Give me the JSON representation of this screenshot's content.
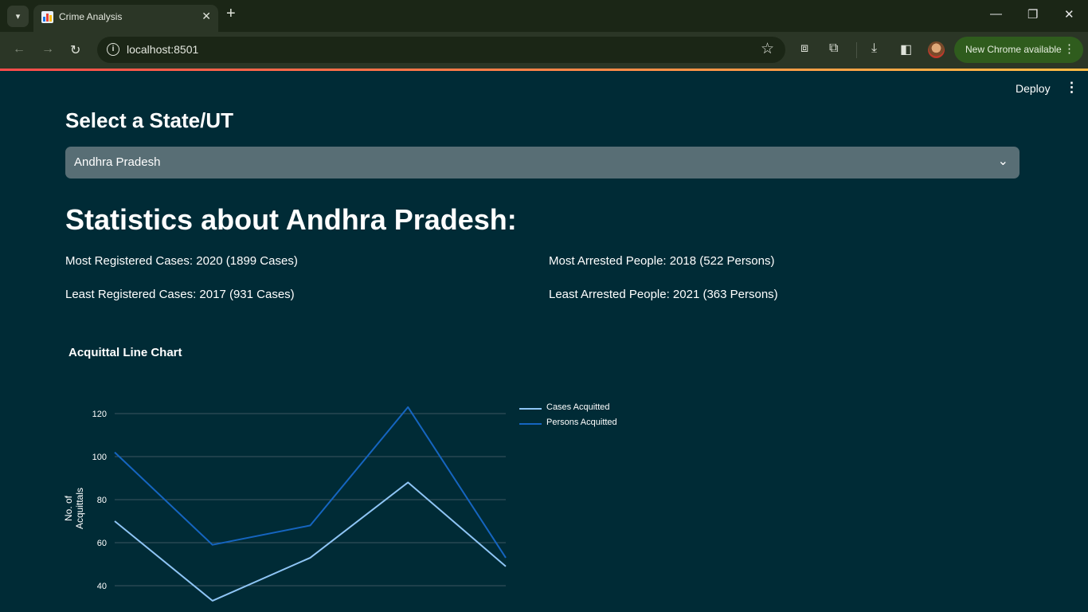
{
  "browser": {
    "tab_title": "Crime Analysis",
    "url": "localhost:8501",
    "update_label": "New Chrome available"
  },
  "app": {
    "deploy_label": "Deploy",
    "select_heading": "Select a State/UT",
    "selected_state": "Andhra Pradesh",
    "stats_heading": "Statistics about Andhra Pradesh:",
    "stats": {
      "most_registered": "Most Registered Cases: 2020 (1899 Cases)",
      "least_registered": "Least Registered Cases: 2017 (931 Cases)",
      "most_arrested": "Most Arrested People: 2018 (522 Persons)",
      "least_arrested": "Least Arrested People: 2021 (363 Persons)"
    },
    "chart_title": "Acquittal Line Chart"
  },
  "colors": {
    "background": "#002b36",
    "selectbox": "#586e75",
    "cases_line": "#8ec5f5",
    "persons_line": "#1565c0"
  },
  "icons": {
    "tab_favicon": "bar-chart-icon",
    "tab_close": "close-icon",
    "new_tab": "plus-icon",
    "back": "arrow-left-icon",
    "forward": "arrow-right-icon",
    "reload": "reload-icon",
    "site_info": "info-icon",
    "bookmark": "star-icon",
    "select_chevron": "chevron-down-icon"
  },
  "chart_data": {
    "type": "line",
    "title": "Acquittal Line Chart",
    "xlabel": "",
    "ylabel": "No. of Acquittals",
    "x": [
      1,
      2,
      3,
      4,
      5
    ],
    "yticks": [
      40,
      60,
      80,
      100,
      120
    ],
    "ylim": [
      30,
      130
    ],
    "grid": true,
    "legend_position": "top-right",
    "series": [
      {
        "name": "Cases Acquitted",
        "values": [
          70,
          33,
          53,
          88,
          49
        ]
      },
      {
        "name": "Persons Acquitted",
        "values": [
          102,
          59,
          68,
          123,
          53
        ]
      }
    ]
  }
}
